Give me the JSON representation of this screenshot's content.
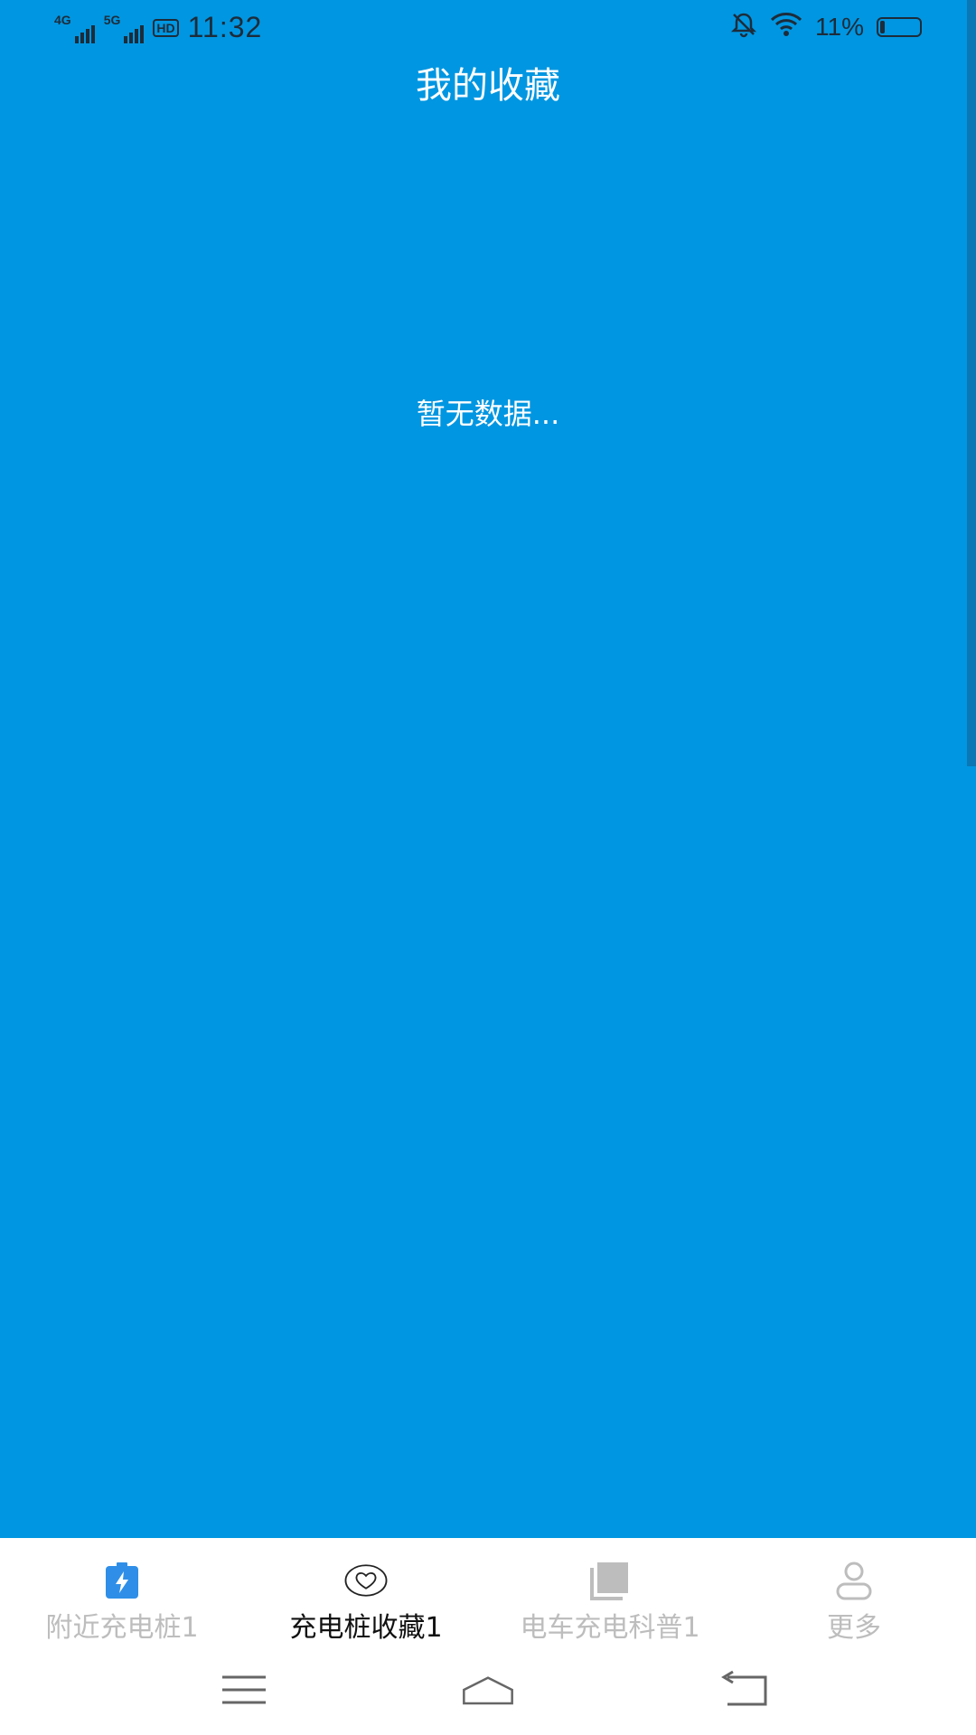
{
  "status_bar": {
    "network_1": "4G",
    "network_2": "5G",
    "hd_badge": "HD",
    "time": "11:32",
    "battery_percent": "11%",
    "battery_level": 0.11,
    "icons": [
      "signal-icon",
      "hd-icon",
      "mute-bell-icon",
      "wifi-icon",
      "battery-icon"
    ]
  },
  "header": {
    "title": "我的收藏"
  },
  "main": {
    "empty_message": "暂无数据..."
  },
  "tabbar": {
    "tabs": [
      {
        "label": "附近充电桩1",
        "icon": "charging-battery-icon",
        "active": false
      },
      {
        "label": "充电桩收藏1",
        "icon": "heart-icon",
        "active": true
      },
      {
        "label": "电车充电科普1",
        "icon": "book-icon",
        "active": false
      },
      {
        "label": "更多",
        "icon": "user-icon",
        "active": false
      }
    ]
  },
  "navbar": {
    "buttons": [
      "menu-icon",
      "home-icon",
      "back-icon"
    ]
  },
  "colors": {
    "background": "#0096E1",
    "tab_active": "#111111",
    "tab_inactive": "#BDBDBD",
    "accent": "#2F8FE8"
  }
}
